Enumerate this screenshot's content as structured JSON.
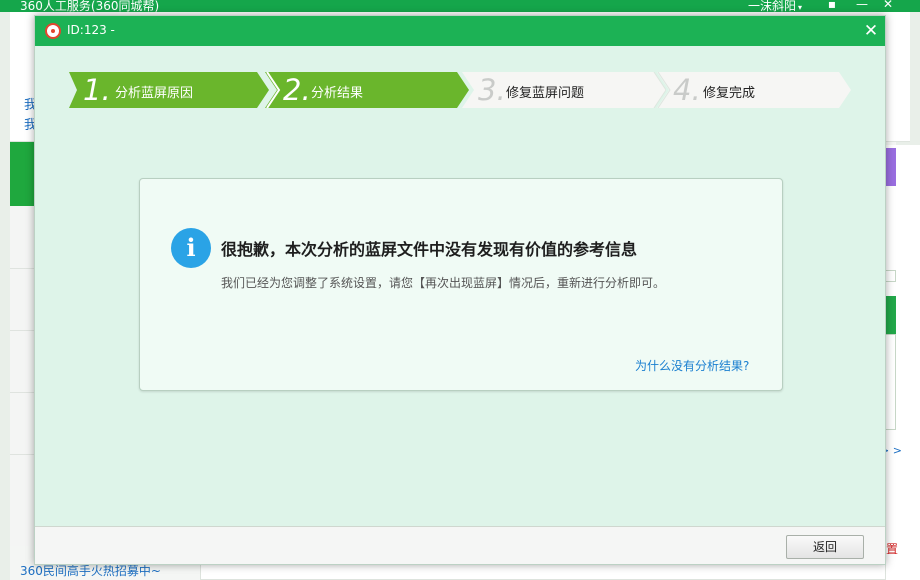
{
  "app": {
    "title": "360人工服务(360同城帮)",
    "user": "一沫斜阳",
    "user_caret": "▾",
    "left_text_1": "我",
    "left_text_2": "我",
    "more_link": "> >",
    "paren": ")",
    "red_text": "置",
    "bottom_text": "360民间高手火热招募中~"
  },
  "window_controls": {
    "chat_glyph": "▪",
    "minimize": "—",
    "close": "✕"
  },
  "dialog": {
    "title": "ID:123 -",
    "close_glyph": "✕",
    "steps": [
      {
        "number": "1.",
        "label": "分析蓝屏原因",
        "state": "done"
      },
      {
        "number": "2.",
        "label": "分析结果",
        "state": "done"
      },
      {
        "number": "3.",
        "label": "修复蓝屏问题",
        "state": "pending"
      },
      {
        "number": "4.",
        "label": "修复完成",
        "state": "pending"
      }
    ],
    "message": {
      "icon": "info-icon",
      "icon_glyph": "i",
      "title": "很抱歉，本次分析的蓝屏文件中没有发现有价值的参考信息",
      "body": "我们已经为您调整了系统设置，请您【再次出现蓝屏】情况后，重新进行分析即可。",
      "link": "为什么没有分析结果?"
    },
    "back_button": "返回"
  },
  "colors": {
    "titlebar_green": "#1cb255",
    "step_active": "#6ab62c",
    "step_inactive": "#f6f6f4",
    "info_blue": "#2aa3e6",
    "link_blue": "#1a7fd0",
    "dialog_bg": "#def4e9"
  }
}
